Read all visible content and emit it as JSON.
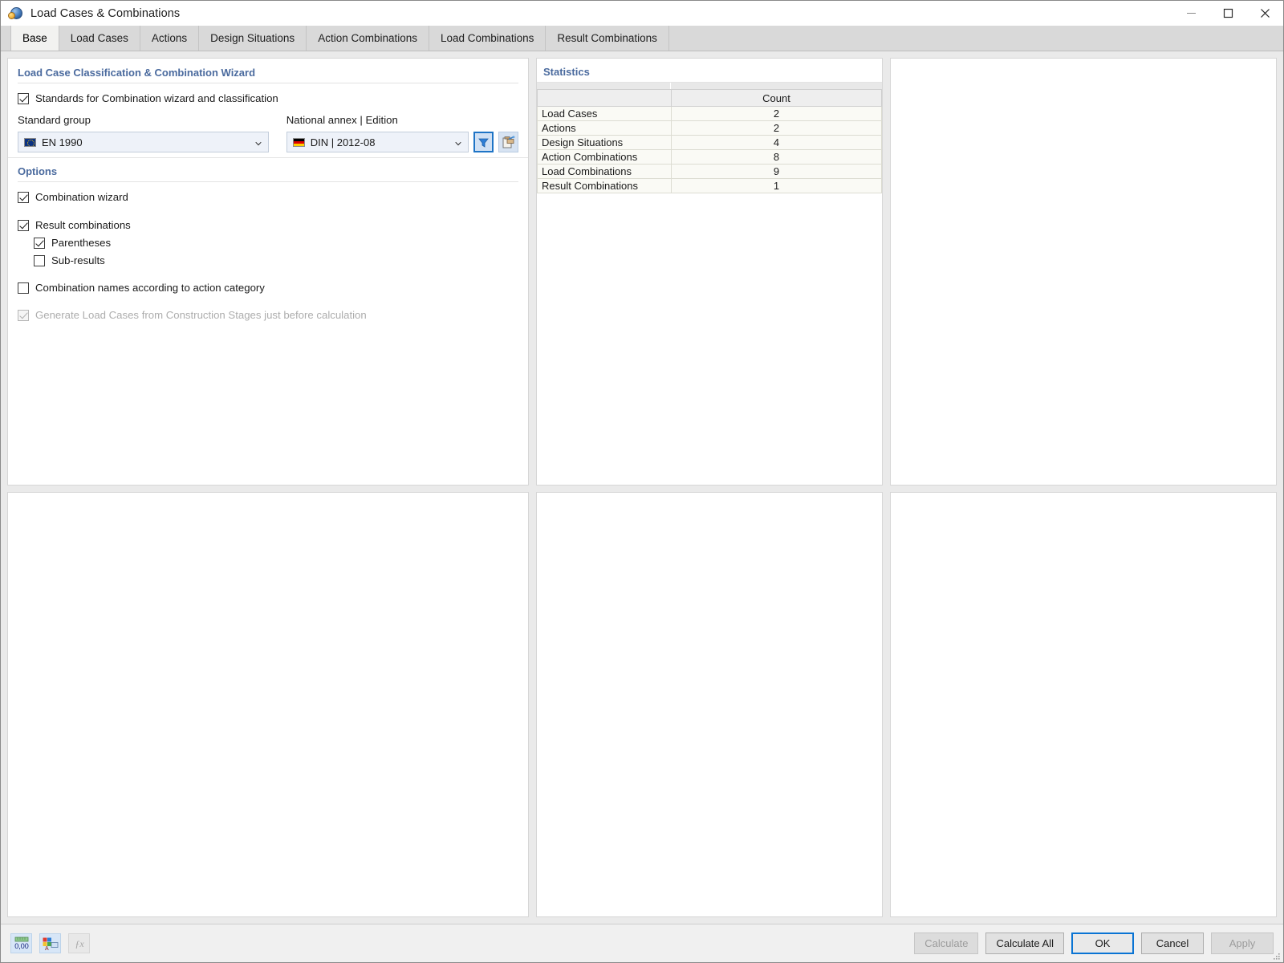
{
  "window": {
    "title": "Load Cases & Combinations",
    "icon": "load-case-globe-icon",
    "minimize_label": "─",
    "maximize_label": "□",
    "close_label": "✕"
  },
  "tabs": [
    {
      "label": "Base",
      "active": true
    },
    {
      "label": "Load Cases",
      "active": false
    },
    {
      "label": "Actions",
      "active": false
    },
    {
      "label": "Design Situations",
      "active": false
    },
    {
      "label": "Action Combinations",
      "active": false
    },
    {
      "label": "Load Combinations",
      "active": false
    },
    {
      "label": "Result Combinations",
      "active": false
    }
  ],
  "left_panel": {
    "classification_section": {
      "title": "Load Case Classification & Combination Wizard",
      "standards_checkbox": {
        "label": "Standards for Combination wizard and classification",
        "checked": true,
        "enabled": true
      },
      "standard_group": {
        "label": "Standard group",
        "value": "EN 1990",
        "flag": "eu-flag-icon"
      },
      "national_annex": {
        "label": "National annex | Edition",
        "value": "DIN | 2012-08",
        "flag": "de-flag-icon",
        "filter_button": "filter-funnel-icon",
        "copy_button": "clipboard-paste-icon"
      }
    },
    "options_section": {
      "title": "Options",
      "items": [
        {
          "label": "Combination wizard",
          "checked": true,
          "enabled": true,
          "indent": false
        },
        {
          "label": "Result combinations",
          "checked": true,
          "enabled": true,
          "indent": false
        },
        {
          "label": "Parentheses",
          "checked": true,
          "enabled": true,
          "indent": true
        },
        {
          "label": "Sub-results",
          "checked": false,
          "enabled": true,
          "indent": true
        },
        {
          "label": "Combination names according to action category",
          "checked": false,
          "enabled": true,
          "indent": false
        },
        {
          "label": "Generate Load Cases from Construction Stages just before calculation",
          "checked": true,
          "enabled": false,
          "indent": false
        }
      ]
    }
  },
  "statistics": {
    "title": "Statistics",
    "columns": [
      "",
      "Count"
    ],
    "rows": [
      {
        "name": "Load Cases",
        "count": "2"
      },
      {
        "name": "Actions",
        "count": "2"
      },
      {
        "name": "Design Situations",
        "count": "4"
      },
      {
        "name": "Action Combinations",
        "count": "8"
      },
      {
        "name": "Load Combinations",
        "count": "9"
      },
      {
        "name": "Result Combinations",
        "count": "1"
      }
    ]
  },
  "footer": {
    "tools": [
      {
        "name": "number-format-icon",
        "label": "0,00",
        "enabled": true
      },
      {
        "name": "rendering-settings-icon",
        "label": "",
        "enabled": true
      },
      {
        "name": "function-fx-icon",
        "label": "ƒx",
        "enabled": false
      }
    ],
    "buttons": [
      {
        "label": "Calculate",
        "enabled": false,
        "default": false
      },
      {
        "label": "Calculate All",
        "enabled": true,
        "default": false
      },
      {
        "label": "OK",
        "enabled": true,
        "default": true
      },
      {
        "label": "Cancel",
        "enabled": true,
        "default": false
      },
      {
        "label": "Apply",
        "enabled": false,
        "default": false
      }
    ]
  },
  "colors": {
    "section_header": "#4a6a9e",
    "accent_blue": "#0a74d4",
    "panel_bg": "#eaeaea",
    "table_row": "#fafaf5"
  }
}
